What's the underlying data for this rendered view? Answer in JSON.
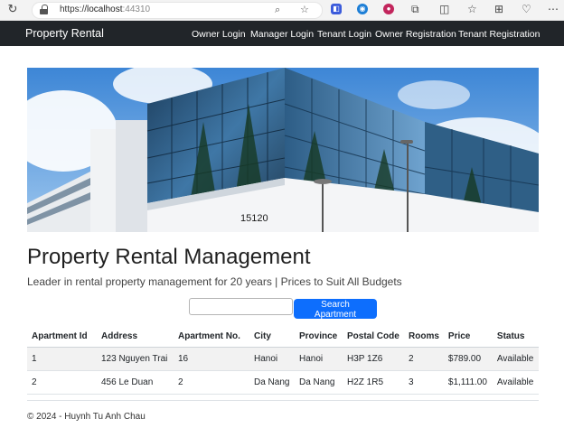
{
  "browser": {
    "url_scheme": "https://",
    "url_host": "localhost",
    "url_port": ":44310"
  },
  "navbar": {
    "brand": "Property Rental",
    "links": [
      "Owner Login",
      "Manager Login",
      "Tenant Login",
      "Owner Registration",
      "Tenant Registration"
    ]
  },
  "hero": {
    "building_number": "15120"
  },
  "main": {
    "title": "Property Rental Management",
    "lead": "Leader in rental property management for 20 years | Prices to Suit All Budgets",
    "search": {
      "placeholder": "",
      "button_label": "Search Apartment"
    }
  },
  "table": {
    "headers": [
      "Apartment Id",
      "Address",
      "Apartment No.",
      "City",
      "Province",
      "Postal Code",
      "Rooms",
      "Price",
      "Status"
    ],
    "rows": [
      [
        "1",
        "123 Nguyen Trai",
        "16",
        "Hanoi",
        "Hanoi",
        "H3P 1Z6",
        "2",
        "$789.00",
        "Available"
      ],
      [
        "2",
        "456 Le Duan",
        "2",
        "Da Nang",
        "Da Nang",
        "H2Z 1R5",
        "3",
        "$1,111.00",
        "Available"
      ]
    ]
  },
  "footer": {
    "text": "© 2024 - Huynh Tu Anh Chau"
  },
  "colors": {
    "navbar_bg": "#212529",
    "primary_button": "#0d6efd"
  }
}
